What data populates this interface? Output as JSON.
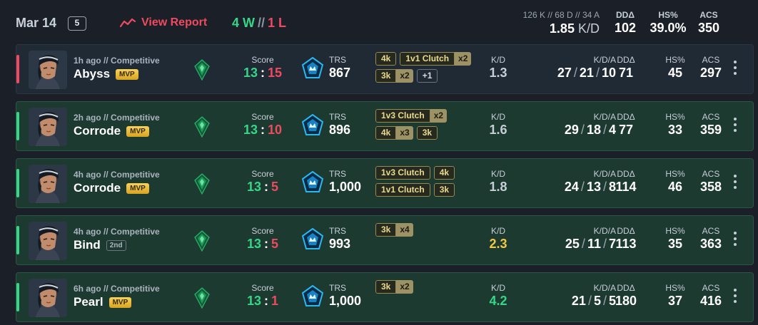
{
  "header": {
    "date": "Mar 14",
    "match_count": "5",
    "view_report": "View Report",
    "wins": "4 W",
    "separator": "//",
    "losses": "1 L",
    "totals_line": "126 K // 68 D // 34 A",
    "kd_value": "1.85",
    "kd_unit": "K/D",
    "stats": [
      {
        "label": "DDΔ",
        "value": "102"
      },
      {
        "label": "HS%",
        "value": "39.0%"
      },
      {
        "label": "ACS",
        "value": "350"
      }
    ]
  },
  "colors": {
    "win": "#35d688",
    "loss": "#ef4a5f",
    "gold": "#f2c744",
    "background": "#1b2028"
  },
  "labels": {
    "score": "Score",
    "trs": "TRS",
    "kd": "K/D",
    "kda": "K/D/A",
    "dd": "DDΔ",
    "hs": "HS%",
    "acs": "ACS"
  },
  "matches": [
    {
      "result": "loss",
      "meta": "1h ago // Competitive",
      "map": "Abyss",
      "badge": "MVP",
      "score_us": "13",
      "score_them": "15",
      "trs": "867",
      "tags": [
        [
          {
            "t": "4k"
          },
          {
            "t": "1v1 Clutch",
            "m": "x2"
          }
        ],
        [
          {
            "t": "3k",
            "m": "x2"
          },
          {
            "t": "+1",
            "plain": true
          }
        ]
      ],
      "kd": "1.3",
      "kd_color": "#c7ced8",
      "k": "27",
      "d": "21",
      "a": "10",
      "dd": "71",
      "hs": "45",
      "acs": "297"
    },
    {
      "result": "win",
      "meta": "2h ago // Competitive",
      "map": "Corrode",
      "badge": "MVP",
      "score_us": "13",
      "score_them": "10",
      "trs": "896",
      "tags": [
        [
          {
            "t": "1v3 Clutch",
            "m": "x2"
          }
        ],
        [
          {
            "t": "4k",
            "m": "x3"
          },
          {
            "t": "3k"
          }
        ]
      ],
      "kd": "1.6",
      "kd_color": "#c7ced8",
      "k": "29",
      "d": "18",
      "a": "4",
      "dd": "77",
      "hs": "33",
      "acs": "359"
    },
    {
      "result": "win",
      "meta": "4h ago // Competitive",
      "map": "Corrode",
      "badge": "MVP",
      "score_us": "13",
      "score_them": "5",
      "trs": "1,000",
      "tags": [
        [
          {
            "t": "1v3 Clutch"
          },
          {
            "t": "4k"
          }
        ],
        [
          {
            "t": "1v1 Clutch"
          },
          {
            "t": "3k"
          }
        ]
      ],
      "kd": "1.8",
      "kd_color": "#c7ced8",
      "k": "24",
      "d": "13",
      "a": "8",
      "dd": "114",
      "hs": "46",
      "acs": "358"
    },
    {
      "result": "win",
      "meta": "4h ago // Competitive",
      "map": "Bind",
      "badge": "2nd",
      "score_us": "13",
      "score_them": "5",
      "trs": "993",
      "tags": [
        [
          {
            "t": "3k",
            "m": "x4"
          }
        ]
      ],
      "kd": "2.3",
      "kd_color": "#f2c744",
      "k": "25",
      "d": "11",
      "a": "7",
      "dd": "113",
      "hs": "35",
      "acs": "363"
    },
    {
      "result": "win",
      "meta": "6h ago // Competitive",
      "map": "Pearl",
      "badge": "MVP",
      "score_us": "13",
      "score_them": "1",
      "trs": "1,000",
      "tags": [
        [
          {
            "t": "3k",
            "m": "x2"
          }
        ]
      ],
      "kd": "4.2",
      "kd_color": "#35d688",
      "k": "21",
      "d": "5",
      "a": "5",
      "dd": "180",
      "hs": "37",
      "acs": "416"
    }
  ]
}
